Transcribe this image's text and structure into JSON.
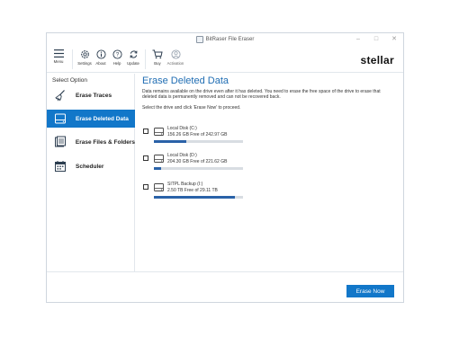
{
  "window": {
    "title": "BitRaser File Eraser"
  },
  "toolbar": {
    "menu_label": "Menu",
    "settings_label": "Settings",
    "about_label": "About",
    "help_label": "Help",
    "update_label": "Update",
    "buy_label": "Buy",
    "activation_label": "Activation"
  },
  "brand": {
    "text": "stellar"
  },
  "sidebar": {
    "title": "Select Option",
    "items": [
      {
        "label": "Erase Traces",
        "icon": "broom-icon"
      },
      {
        "label": "Erase Deleted Data",
        "icon": "drive-icon",
        "active": true
      },
      {
        "label": "Erase Files & Folders",
        "icon": "files-icon"
      },
      {
        "label": "Scheduler",
        "icon": "calendar-icon"
      }
    ]
  },
  "main": {
    "heading": "Erase Deleted Data",
    "description": "Data remains available on the drive even after it has deleted. You need to erase the free space of the drive to erase that deleted data is permanently removed and can not be recovered back.",
    "instruction": "Select the drive and click 'Erase Now' to proceed.",
    "drives": [
      {
        "name": "Local Disk  (C:)",
        "free": "156.26 GB Free of 242.97 GB",
        "used_fraction": 0.36
      },
      {
        "name": "Local Disk  (D:)",
        "free": "204.30 GB Free of 221.62 GB",
        "used_fraction": 0.08
      },
      {
        "name": "SITPL Backup (I:)",
        "free": "2.50 TB Free of 29.11 TB",
        "used_fraction": 0.91
      }
    ]
  },
  "footer": {
    "erase_button": "Erase Now"
  },
  "colors": {
    "accent": "#1277c9",
    "heading": "#1f6db3",
    "bar_fill": "#2a62a8",
    "bar_bg": "#d8dde2"
  }
}
